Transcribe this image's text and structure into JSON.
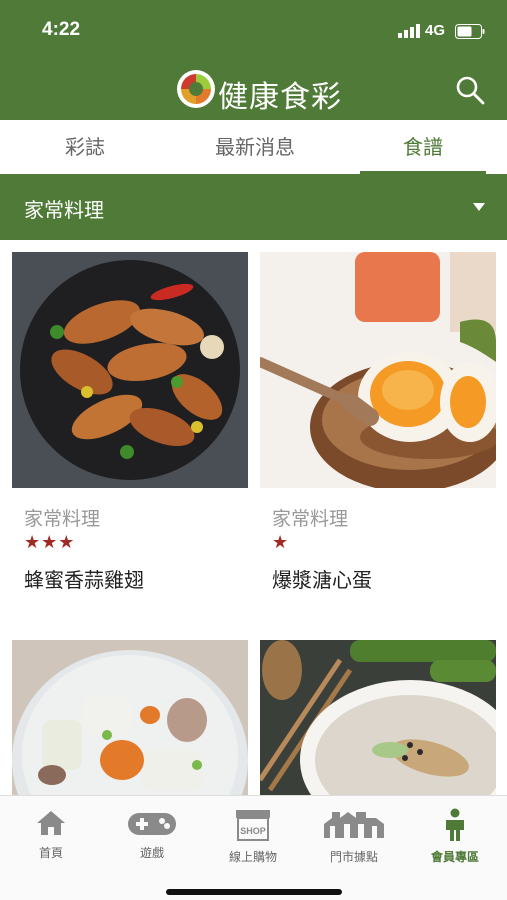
{
  "status": {
    "time": "4:22",
    "network": "4G"
  },
  "app": {
    "title": "健康食彩"
  },
  "tabs": [
    {
      "label": "彩誌"
    },
    {
      "label": "最新消息"
    },
    {
      "label": "食譜"
    }
  ],
  "category_filter": {
    "label": "家常料理"
  },
  "recipes": [
    {
      "category": "家常料理",
      "stars": "★★★",
      "rating": 3,
      "name": "蜂蜜香蒜雞翅"
    },
    {
      "category": "家常料理",
      "stars": "★",
      "rating": 1,
      "name": "爆漿溏心蛋"
    },
    {
      "category": "",
      "stars": "",
      "rating": null,
      "name": ""
    },
    {
      "category": "",
      "stars": "",
      "rating": null,
      "name": ""
    }
  ],
  "bottom_nav": [
    {
      "label": "首頁",
      "icon": "home-icon"
    },
    {
      "label": "遊戲",
      "icon": "gamepad-icon"
    },
    {
      "label": "線上購物",
      "icon": "shop-icon"
    },
    {
      "label": "門市據點",
      "icon": "store-locations-icon"
    },
    {
      "label": "會員專區",
      "icon": "member-icon"
    }
  ],
  "shop_icon_text": "SHOP",
  "colors": {
    "brand_green": "#4f7a37",
    "star_red": "#a22a24"
  }
}
